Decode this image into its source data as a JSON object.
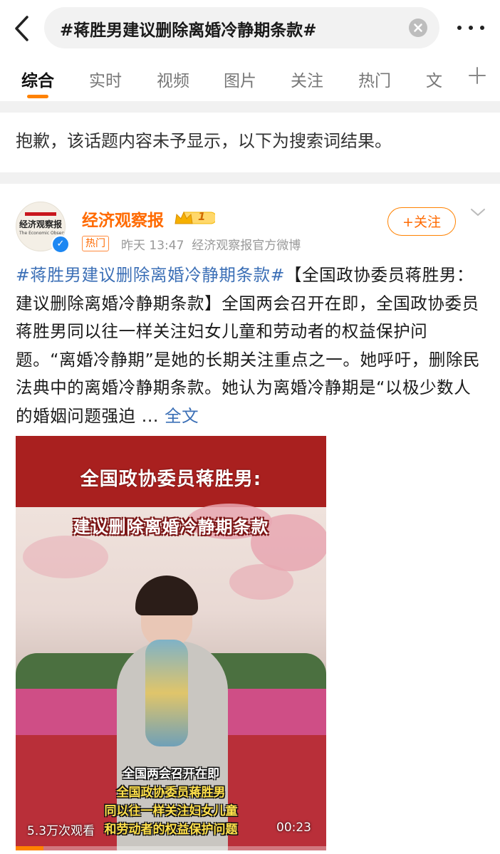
{
  "header": {
    "search_query": "#蒋胜男建议删除离婚冷静期条款#"
  },
  "tabs": [
    {
      "label": "综合"
    },
    {
      "label": "实时"
    },
    {
      "label": "视频"
    },
    {
      "label": "图片"
    },
    {
      "label": "关注"
    },
    {
      "label": "热门"
    },
    {
      "label": "文"
    }
  ],
  "notice": "抱歉，该话题内容未予显示，以下为搜索词结果。",
  "post": {
    "avatar_logo": "经济观察报",
    "avatar_sub": "The Economic Observer",
    "author": "经济观察报",
    "vip_level": "1",
    "hot_badge": "热门",
    "time": "昨天 13:47",
    "source": "经济观察报官方微博",
    "follow_label": "+关注",
    "topic": "#蒋胜男建议删除离婚冷静期条款#",
    "text": "【全国政协委员蒋胜男：建议删除离婚冷静期条款】全国两会召开在即，全国政协委员蒋胜男同以往一样关注妇女儿童和劳动者的权益保护问题。“离婚冷静期”是她的长期关注重点之一。她呼吁，删除民法典中的离婚冷静期条款。她认为离婚冷静期是“以极少数人的婚姻问题强迫 ...",
    "full_link": "全文"
  },
  "video": {
    "title_line1": "全国政协委员蒋胜男:",
    "title_line2": "建议删除离婚冷静期条款",
    "subtitles": [
      "全国两会召开在即",
      "全国政协委员蒋胜男",
      "同以往一样关注妇女儿童",
      "和劳动者的权益保护问题"
    ],
    "views": "5.3万次观看",
    "duration": "00:23",
    "progress_fraction": 0.09
  },
  "colors": {
    "accent": "#ff8200",
    "link": "#3b6fb6",
    "author": "#ff6a00"
  }
}
